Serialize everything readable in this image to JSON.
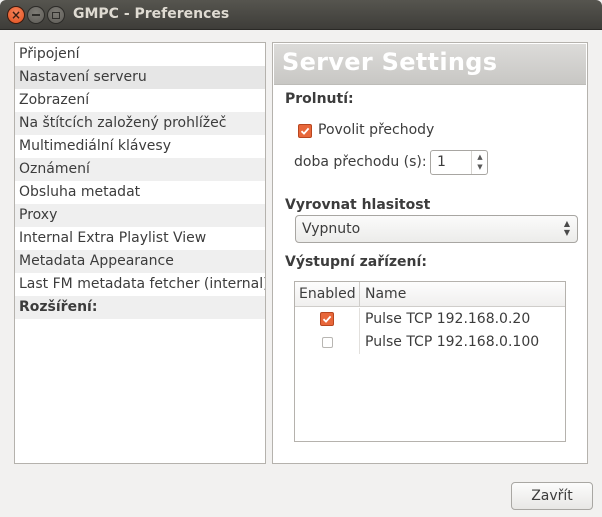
{
  "window": {
    "title": "GMPC - Preferences",
    "close_icon": "×",
    "minimize_icon": "minimize",
    "maximize_icon": "maximize"
  },
  "categories": [
    {
      "label": "Připojení",
      "selected": false,
      "bold": false
    },
    {
      "label": "Nastavení serveru",
      "selected": true,
      "bold": false
    },
    {
      "label": "Zobrazení",
      "selected": false,
      "bold": false
    },
    {
      "label": "Na štítcích založený prohlížeč",
      "selected": false,
      "bold": false
    },
    {
      "label": "Multimediální klávesy",
      "selected": false,
      "bold": false
    },
    {
      "label": "Oznámení",
      "selected": false,
      "bold": false
    },
    {
      "label": "Obsluha metadat",
      "selected": false,
      "bold": false
    },
    {
      "label": "Proxy",
      "selected": false,
      "bold": false
    },
    {
      "label": "Internal Extra Playlist View",
      "selected": false,
      "bold": false
    },
    {
      "label": "Metadata Appearance",
      "selected": false,
      "bold": false
    },
    {
      "label": "Last FM metadata fetcher (internal)",
      "selected": false,
      "bold": false
    },
    {
      "label": "Rozšíření:",
      "selected": false,
      "bold": true
    }
  ],
  "server_settings": {
    "banner_title": "Server Settings",
    "crossfade": {
      "section_label": "Prolnutí:",
      "enable_label": "Povolit přechody",
      "enable_checked": true,
      "duration_label": "doba přechodu (s):",
      "duration_value": "1",
      "spin_up": "▲",
      "spin_down": "▼"
    },
    "replaygain": {
      "section_label": "Vyrovnat hlasitost",
      "selected_option": "Vypnuto",
      "arrows": "▲\n▼"
    },
    "outputs": {
      "section_label": "Výstupní zařízení:",
      "columns": [
        "Enabled",
        "Name"
      ],
      "rows": [
        {
          "enabled": true,
          "name": "Pulse TCP 192.168.0.20"
        },
        {
          "enabled": false,
          "name": "Pulse TCP 192.168.0.100"
        }
      ]
    }
  },
  "footer": {
    "close_label": "Zavřít"
  },
  "colors": {
    "accent": "#e8673a",
    "titlebar": "#3e3d39",
    "window_bg": "#f2f1f0"
  }
}
